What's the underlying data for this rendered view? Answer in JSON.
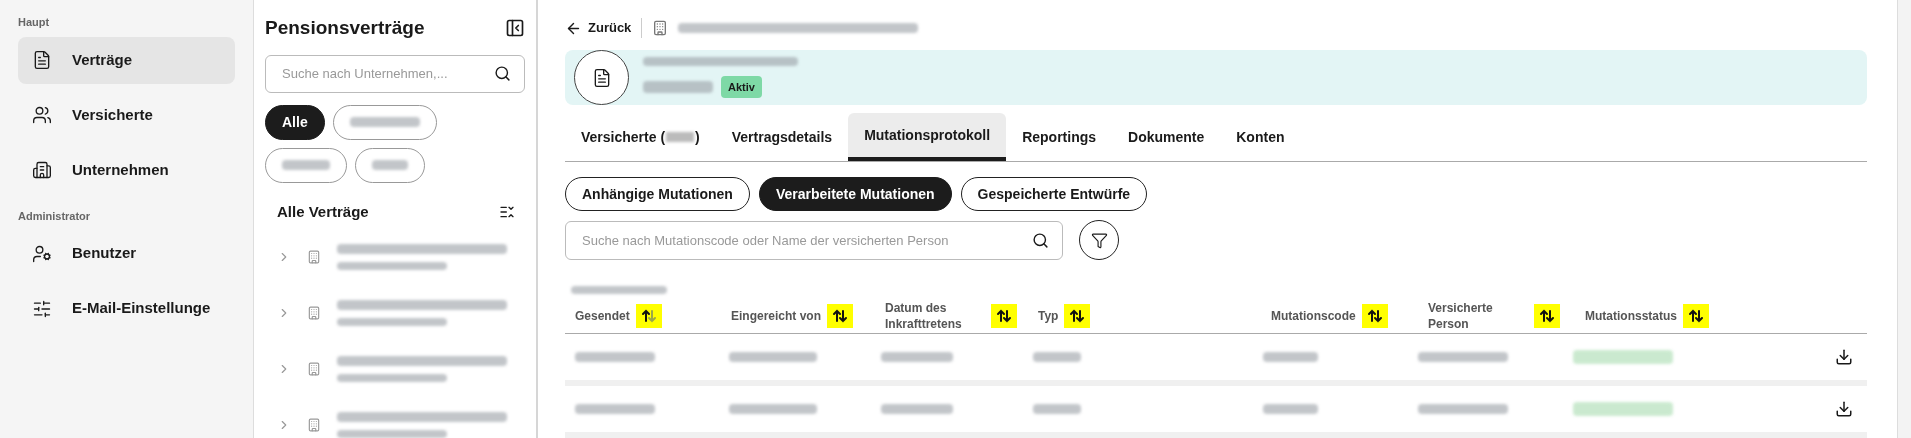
{
  "nav": {
    "sections": [
      {
        "title": "Haupt",
        "items": [
          {
            "label": "Verträge",
            "kind": "contracts",
            "selected": true
          },
          {
            "label": "Versicherte",
            "kind": "insured",
            "selected": false
          },
          {
            "label": "Unternehmen",
            "kind": "companies",
            "selected": false
          }
        ]
      },
      {
        "title": "Administrator",
        "items": [
          {
            "label": "Benutzer",
            "kind": "users",
            "selected": false
          },
          {
            "label": "E-Mail-Einstellunge",
            "kind": "email",
            "selected": false
          }
        ]
      }
    ]
  },
  "contracts_panel": {
    "title": "Pensionsverträge",
    "search": {
      "placeholder": "Suche nach Unternehmen,..."
    },
    "filters": [
      {
        "label": "Alle",
        "selected": true
      },
      {
        "selected": false
      },
      {
        "selected": false
      },
      {
        "selected": false
      }
    ],
    "list_title": "Alle Verträge",
    "companies": [
      {
        "expanded": false
      },
      {
        "expanded": false
      },
      {
        "expanded": false
      },
      {
        "expanded": false
      }
    ]
  },
  "back_label": "Zurück",
  "contract": {
    "status": "Aktiv"
  },
  "tabs": [
    {
      "label": "Versicherte (",
      "suffix": ")",
      "selected": false
    },
    {
      "label": "Vertragsdetails",
      "selected": false
    },
    {
      "label": "Mutationsprotokoll",
      "selected": true
    },
    {
      "label": "Reportings",
      "selected": false
    },
    {
      "label": "Dokumente",
      "selected": false
    },
    {
      "label": "Konten",
      "selected": false
    }
  ],
  "subtabs": [
    {
      "label": "Anhängige Mutationen",
      "selected": false
    },
    {
      "label": "Verarbeitete Mutationen",
      "selected": true
    },
    {
      "label": "Gespeicherte Entwürfe",
      "selected": false
    }
  ],
  "search": {
    "placeholder": "Suche nach Mutationscode oder Name der versicherten Person"
  },
  "table": {
    "columns": [
      {
        "label": "Gesendet",
        "sorted": true
      },
      {
        "label": "Eingereicht von",
        "sorted": false
      },
      {
        "label": "Datum des Inkrafttretens",
        "sorted": false
      },
      {
        "label": "Typ",
        "sorted": false
      },
      {
        "label": "Mutationscode",
        "sorted": false
      },
      {
        "label": "Versicherte Person",
        "sorted": false
      },
      {
        "label": "Mutationsstatus",
        "sorted": false
      }
    ],
    "rows": [
      {
        "downloadable": true
      },
      {
        "downloadable": true
      }
    ]
  }
}
